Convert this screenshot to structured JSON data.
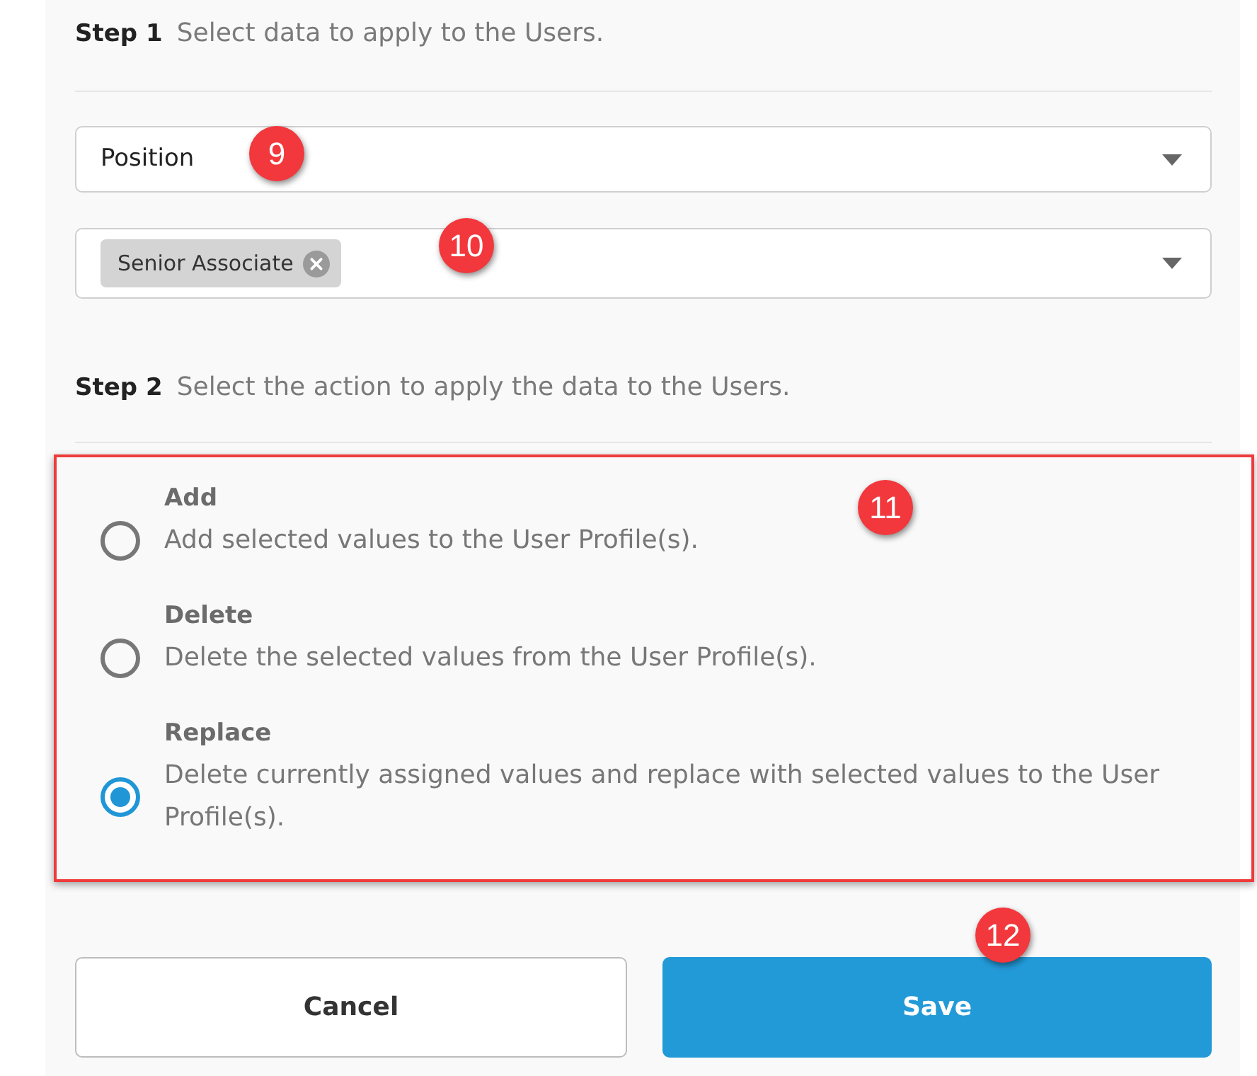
{
  "step1": {
    "label": "Step 1",
    "text": "Select data to apply to the Users."
  },
  "field_select": {
    "value": "Position"
  },
  "values_select": {
    "chips": [
      {
        "label": "Senior Associate"
      }
    ]
  },
  "step2": {
    "label": "Step 2",
    "text": "Select the action to apply the data to the Users."
  },
  "actions": {
    "highlighted": true,
    "options": [
      {
        "title": "Add",
        "description": "Add selected values to the User Profile(s).",
        "selected": false
      },
      {
        "title": "Delete",
        "description": "Delete the selected values from the User Profile(s).",
        "selected": false
      },
      {
        "title": "Replace",
        "description": "Delete currently assigned values and replace with selected values to the User Profile(s).",
        "selected": true
      }
    ]
  },
  "buttons": [
    {
      "label": "Cancel",
      "kind": "secondary"
    },
    {
      "label": "Save",
      "kind": "primary"
    }
  ],
  "callouts": [
    {
      "label": "9"
    },
    {
      "label": "10"
    },
    {
      "label": "11"
    },
    {
      "label": "12"
    }
  ]
}
